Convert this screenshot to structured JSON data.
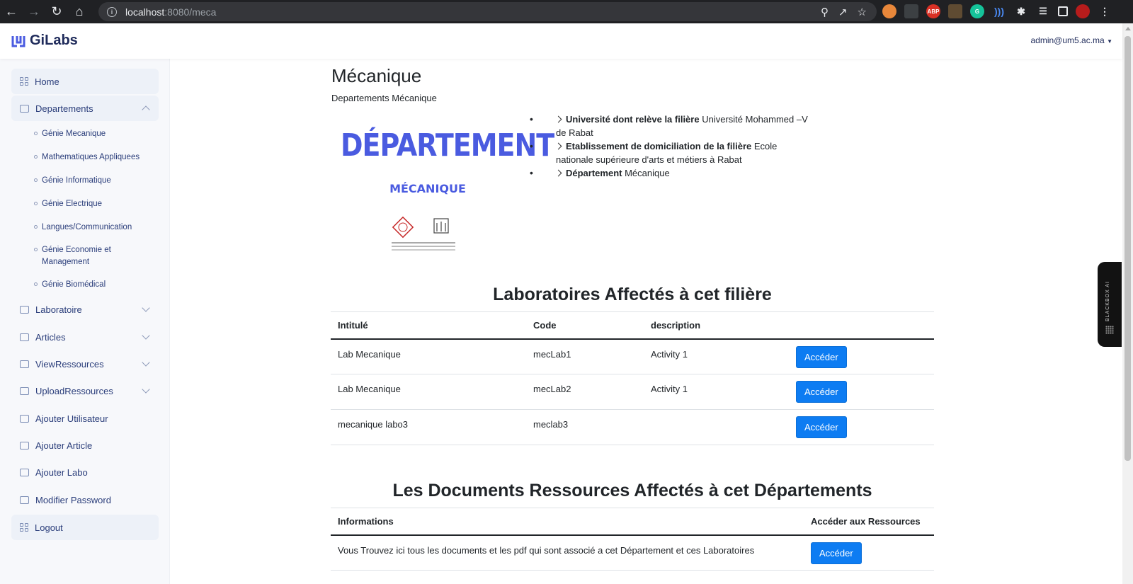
{
  "browser": {
    "url_host": "localhost",
    "url_rest": ":8080/meca"
  },
  "header": {
    "brand": "GiLabs",
    "user": "admin@um5.ac.ma"
  },
  "sidebar": {
    "home": "Home",
    "departements": "Departements",
    "sub_items": [
      "Génie Mecanique",
      "Mathematiques Appliquees",
      "Génie Informatique",
      "Génie Electrique",
      "Langues/Communication",
      "Génie Economie et Management",
      "Génie Biomédical"
    ],
    "laboratoire": "Laboratoire",
    "articles": "Articles",
    "view_ressources": "ViewRessources",
    "upload_ressources": "UploadRessources",
    "ajouter_utilisateur": "Ajouter Utilisateur",
    "ajouter_article": "Ajouter Article",
    "ajouter_labo": "Ajouter Labo",
    "modifier_password": "Modifier Password",
    "logout": "Logout"
  },
  "page": {
    "title": "Mécanique",
    "subtitle": "Departements Mécanique",
    "image_big": "DÉPARTEMENT",
    "image_small": "MÉCANIQUE",
    "info": [
      {
        "label": "Université dont relève la filière",
        "value": "Université Mohammed –V de Rabat"
      },
      {
        "label": "Etablissement de domiciliation de la filière",
        "value": "Ecole nationale supérieure d'arts et métiers à Rabat"
      },
      {
        "label": "Département",
        "value": "Mécanique"
      }
    ]
  },
  "labs": {
    "title": "Laboratoires Affectés à cet filière",
    "headers": [
      "Intitulé",
      "Code",
      "description"
    ],
    "button_label": "Accéder",
    "rows": [
      {
        "intitule": "Lab Mecanique",
        "code": "mecLab1",
        "description": "Activity 1"
      },
      {
        "intitule": "Lab Mecanique",
        "code": "mecLab2",
        "description": "Activity 1"
      },
      {
        "intitule": "mecanique labo3",
        "code": "meclab3",
        "description": ""
      }
    ]
  },
  "documents": {
    "title": "Les Documents Ressources Affectés à cet Départements",
    "headers": [
      "Informations",
      "Accéder aux Ressources"
    ],
    "row_text": "Vous Trouvez ici tous les documents et les pdf qui sont associé a cet Département et ces Laboratoires",
    "button_label": "Accéder"
  },
  "widget": {
    "label": "BLACKBOX AI"
  },
  "colors": {
    "primary_button": "#0d7cf2",
    "brand": "#4a5be0",
    "nav_text": "#2a3d7a"
  }
}
